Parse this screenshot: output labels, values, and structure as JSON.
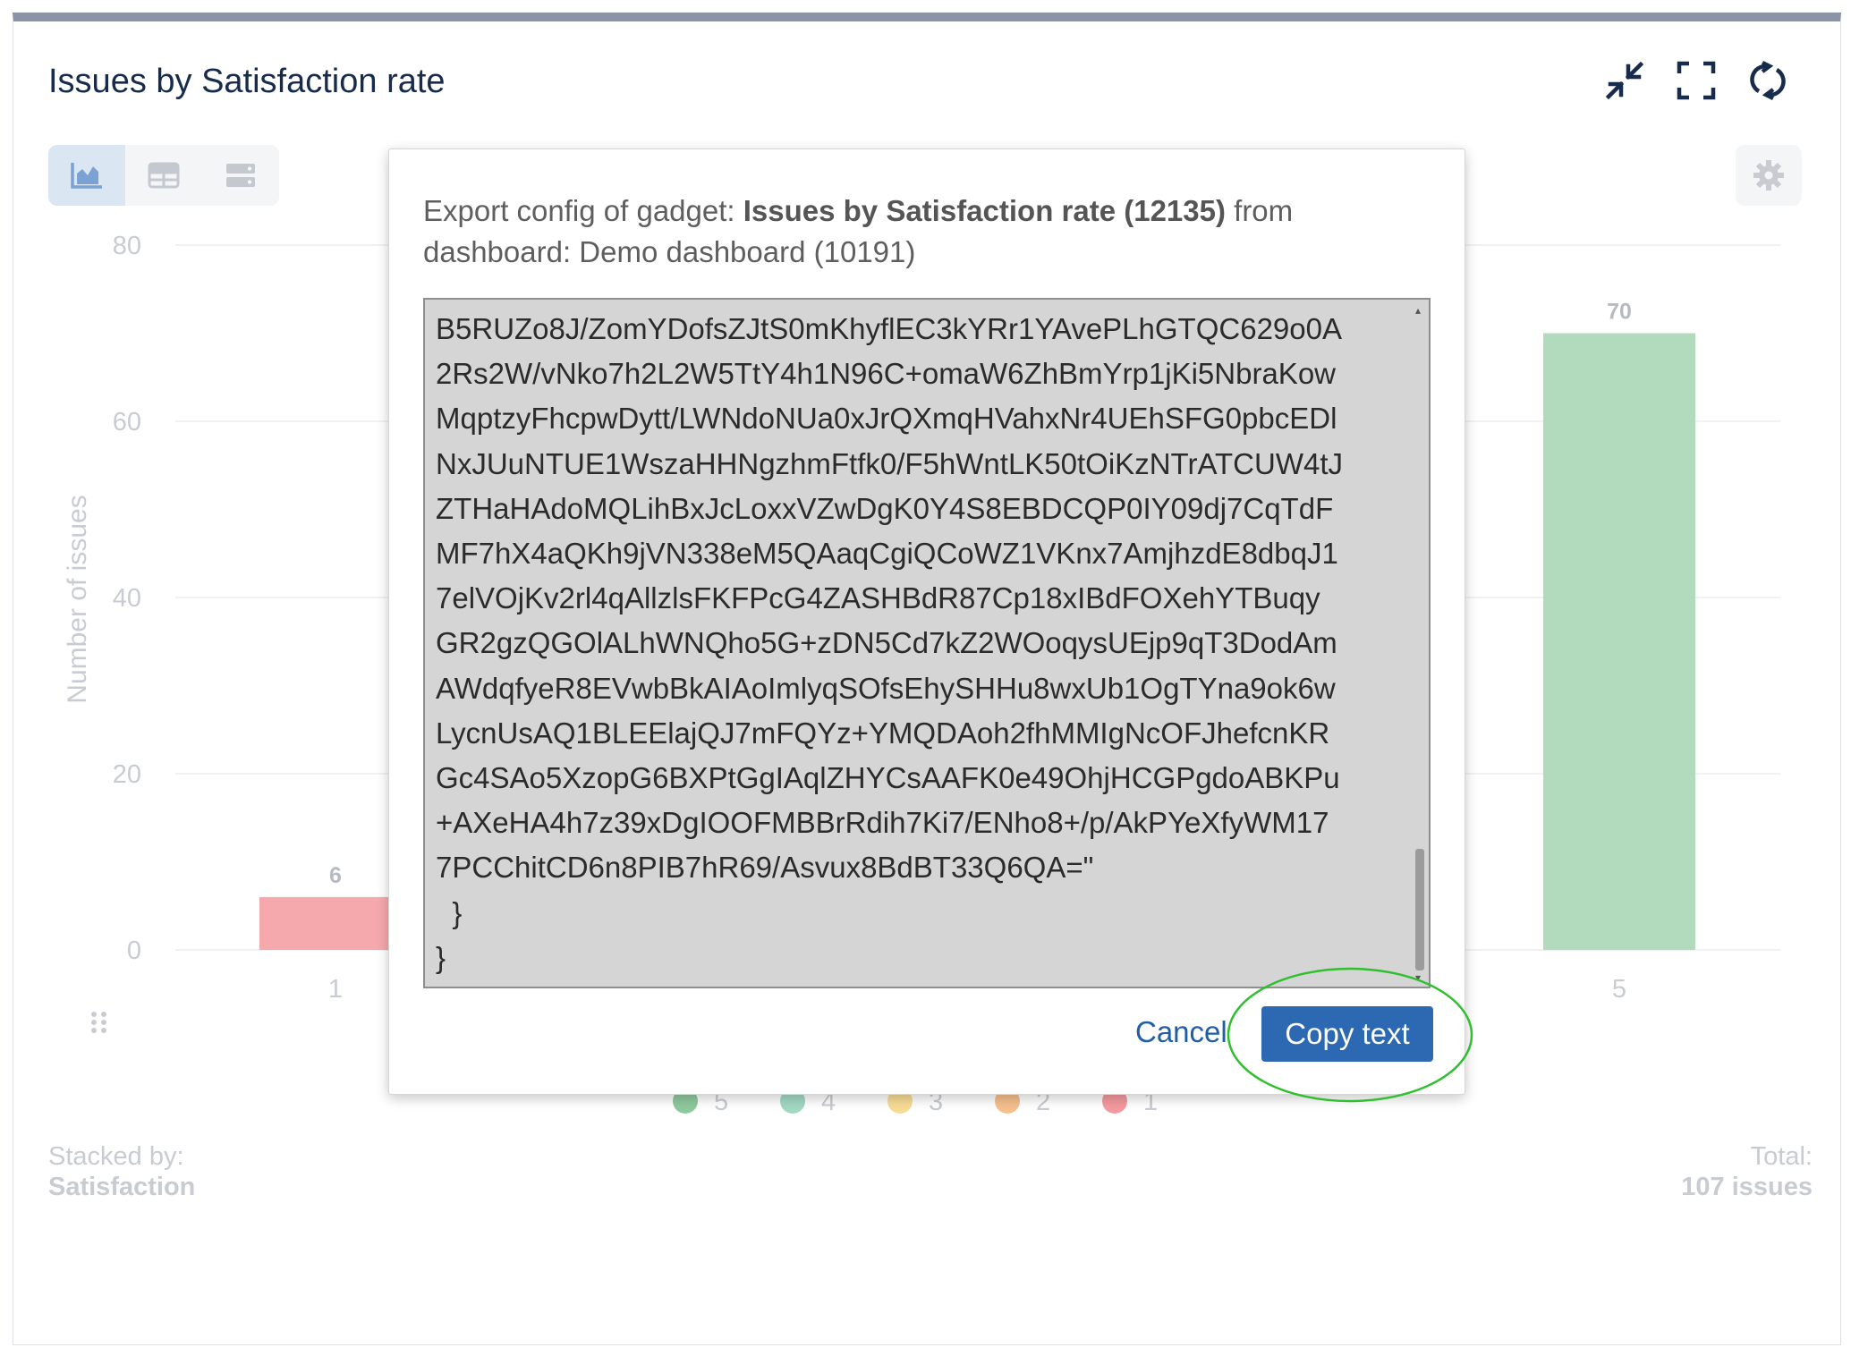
{
  "gadget": {
    "title": "Issues by Satisfaction rate",
    "header_icons": [
      "minimize-icon",
      "fullscreen-icon",
      "refresh-icon"
    ],
    "view_buttons": [
      "bar-chart-view-icon",
      "table-view-icon",
      "list-view-icon"
    ],
    "stacked_by_label": "Stacked by:",
    "stacked_by_value": "Satisfaction",
    "total_label": "Total:",
    "total_value": "107 issues"
  },
  "chart_data": {
    "type": "bar",
    "ylabel": "Number of issues",
    "ylim": [
      0,
      80
    ],
    "yticks": [
      "0",
      "20",
      "40",
      "60",
      "80"
    ],
    "visible_categories": [
      "1",
      "5"
    ],
    "visible_values": [
      6,
      70
    ],
    "value_labels": [
      "6",
      "70"
    ],
    "bar_colors": [
      "#f5a9ad",
      "#b1dbbc"
    ],
    "legend": [
      {
        "label": "5",
        "color": "#8fc99e"
      },
      {
        "label": "4",
        "color": "#a2d9c3"
      },
      {
        "label": "3",
        "color": "#f7dc96"
      },
      {
        "label": "2",
        "color": "#f5bf8e"
      },
      {
        "label": "1",
        "color": "#f39a9e"
      }
    ]
  },
  "modal": {
    "prefix": "Export config of gadget: ",
    "gadget_name": "Issues by Satisfaction rate (12135)",
    "suffix": " from dashboard: Demo dashboard (10191)",
    "code": "B5RUZo8J/ZomYDofsZJtS0mKhyflEC3kYRr1YAvePLhGTQC629o0A\n2Rs2W/vNko7h2L2W5TtY4h1N96C+omaW6ZhBmYrp1jKi5NbraKow\nMqptzyFhcpwDytt/LWNdoNUa0xJrQXmqHVahxNr4UEhSFG0pbcEDl\nNxJUuNTUE1WszaHHNgzhmFtfk0/F5hWntLK50tOiKzNTrATCUW4tJ\nZTHaHAdoMQLihBxJcLoxxVZwDgK0Y4S8EBDCQP0IY09dj7CqTdF\nMF7hX4aQKh9jVN338eM5QAaqCgiQCoWZ1VKnx7AmjhzdE8dbqJ1\n7elVOjKv2rl4qAllzlsFKFPcG4ZASHBdR87Cp18xIBdFOXehYTBuqy\nGR2gzQGOlALhWNQho5G+zDN5Cd7kZ2WOoqysUEjp9qT3DodAm\nAWdqfyeR8EVwbBkAIAoImlyqSOfsEhySHHu8wxUb1OgTYna9ok6w\nLycnUsAQ1BLEElajQJ7mFQYz+YMQDAoh2fhMMIgNcOFJhefcnKR\nGc4SAo5XzopG6BXPtGgIAqlZHYCsAAFK0e49OhjHCGPgdoABKPu\n+AXeHA4h7z39xDgIOOFMBBrRdih7Ki7/ENho8+/p/AkPYeXfyWM17\n7PCChitCD6n8PIB7hR69/Asvux8BdBT33Q6QA=\"\n  }\n}",
    "cancel_label": "Cancel",
    "copy_label": "Copy text"
  }
}
